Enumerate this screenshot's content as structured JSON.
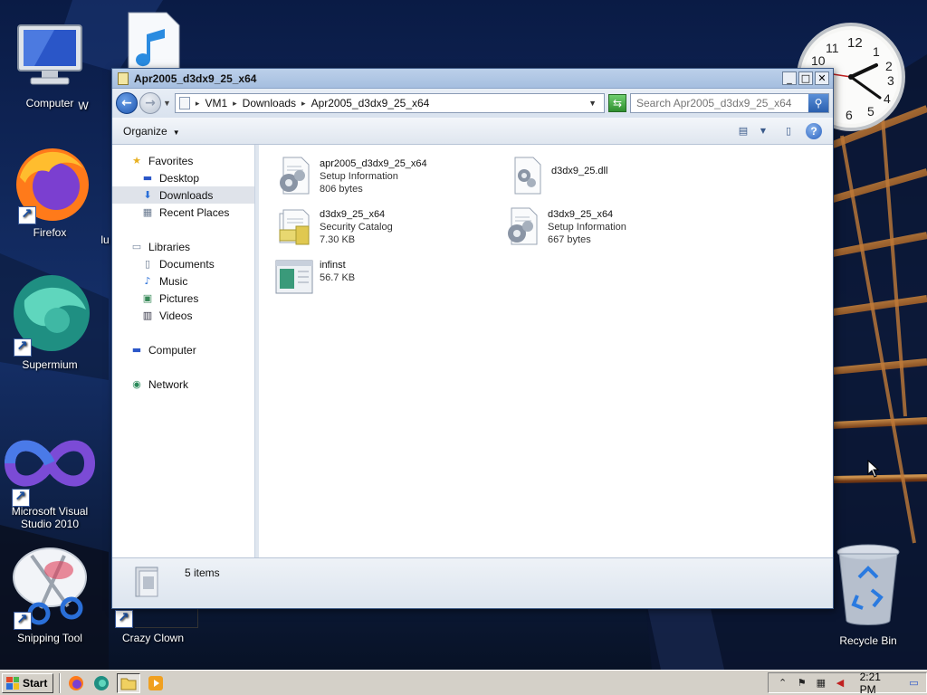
{
  "desktop": {
    "icons": [
      {
        "label": "Computer",
        "icon": "computer-monitor-icon"
      },
      {
        "label": "W",
        "icon": "music-file-icon"
      },
      {
        "label": "Firefox",
        "icon": "firefox-icon"
      },
      {
        "label": "Supermium",
        "icon": "supermium-icon"
      },
      {
        "label": "Microsoft Visual Studio 2010",
        "icon": "visual-studio-icon"
      },
      {
        "label": "Snipping Tool",
        "icon": "scissors-icon"
      },
      {
        "label": "Crazy Clown",
        "icon": "shortcut-icon"
      },
      {
        "label": "Recycle Bin",
        "icon": "recycle-bin-icon"
      },
      {
        "label": "lu",
        "icon": "partial-icon"
      }
    ],
    "clock": {
      "numerals": [
        "12",
        "1",
        "2",
        "3",
        "4",
        "5",
        "6",
        "10",
        "11"
      ]
    }
  },
  "window": {
    "title": "Apr2005_d3dx9_25_x64",
    "controls": {
      "minimize": "_",
      "maximize": "□",
      "close": "✕"
    },
    "address": {
      "crumbs": [
        "VM1",
        "Downloads",
        "Apr2005_d3dx9_25_x64"
      ]
    },
    "search": {
      "placeholder": "Search Apr2005_d3dx9_25_x64"
    },
    "toolbar": {
      "organize": "Organize"
    },
    "nav": {
      "favorites": "Favorites",
      "favorites_items": [
        "Desktop",
        "Downloads",
        "Recent Places"
      ],
      "libraries": "Libraries",
      "libraries_items": [
        "Documents",
        "Music",
        "Pictures",
        "Videos"
      ],
      "computer": "Computer",
      "network": "Network"
    },
    "files": [
      {
        "name": "apr2005_d3dx9_25_x64",
        "type": "Setup Information",
        "size": "806 bytes",
        "icon": "setup-info-icon"
      },
      {
        "name": "d3dx9_25.dll",
        "type": "",
        "size": "",
        "icon": "dll-gear-icon"
      },
      {
        "name": "d3dx9_25_x64",
        "type": "Security Catalog",
        "size": "7.30 KB",
        "icon": "security-catalog-icon"
      },
      {
        "name": "d3dx9_25_x64",
        "type": "Setup Information",
        "size": "667 bytes",
        "icon": "setup-info-icon"
      },
      {
        "name": "infinst",
        "type": "",
        "size": "56.7 KB",
        "icon": "executable-icon"
      }
    ],
    "status": {
      "count": "5 items"
    }
  },
  "taskbar": {
    "start": "Start",
    "time": "2:21 PM"
  }
}
